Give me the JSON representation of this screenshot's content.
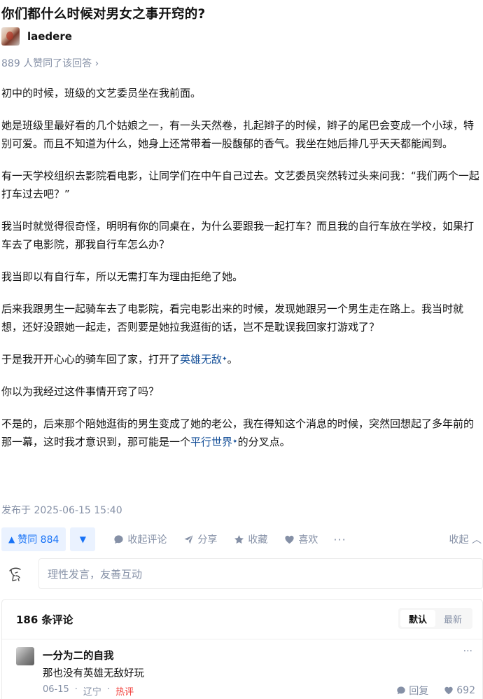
{
  "question": {
    "title": "你们都什么时候对男女之事开窍的?"
  },
  "author": {
    "name": "laedere"
  },
  "upvote_summary": "889 人赞同了该回答 ›",
  "answer": {
    "paragraphs": [
      "初中的时候，班级的文艺委员坐在我前面。",
      "她是班级里最好看的几个姑娘之一，有一头天然卷，扎起辫子的时候，辫子的尾巴会变成一个小球，特别可爱。而且不知道为什么，她身上还常带着一股馥郁的香气。我坐在她后排几乎天天都能闻到。",
      "有一天学校组织去影院看电影，让同学们在中午自己过去。文艺委员突然转过头来问我：“我们两个一起打车过去吧？”",
      "我当时就觉得很奇怪，明明有你的同桌在，为什么要跟我一起打车？而且我的自行车放在学校，如果打车去了电影院，那我自行车怎么办？",
      "我当即以有自行车，所以无需打车为理由拒绝了她。",
      "后来我跟男生一起骑车去了电影院，看完电影出来的时候，发现她跟另一个男生走在路上。我当时就想，还好没跟她一起走，否则要是她拉我逛街的话，岂不是耽误我回家打游戏了？"
    ],
    "p7_before": "于是我开开心心的骑车回了家，打开了",
    "p7_link": "英雄无敌",
    "p7_after": "。",
    "p8": "你以为我经过这件事情开窍了吗？",
    "p9_before": "不是的，后来那个陪她逛街的男生变成了她的老公，我在得知这个消息的时候，突然回想起了多年前的那一幕，这时我才意识到，那可能是一个",
    "p9_link": "平行世界",
    "p9_after": "的分叉点。",
    "spark": "✦"
  },
  "published": "发布于 2025-06-15 15:40",
  "actions": {
    "vote_icon": "▲",
    "vote_label": "赞同 884",
    "down_icon": "▼",
    "comments_label": "收起评论",
    "share_label": "分享",
    "favorite_label": "收藏",
    "like_label": "喜欢",
    "more": "···",
    "collapse_label": "收起 ︿"
  },
  "comment_input": {
    "placeholder": "理性发言，友善互动"
  },
  "comments": {
    "count_label": "186 条评论",
    "sort_default": "默认",
    "sort_latest": "最新",
    "items": [
      {
        "author": "一分为二的自我",
        "text": "那也没有英雄无敌好玩",
        "date": "06-15",
        "location": "辽宁",
        "tag": "热评",
        "more": "···",
        "reply_label": "回复",
        "likes": "692"
      }
    ]
  },
  "colors": {
    "accent": "#1772f6",
    "link": "#175199",
    "muted": "#8590a6",
    "hot": "#f1403c"
  }
}
